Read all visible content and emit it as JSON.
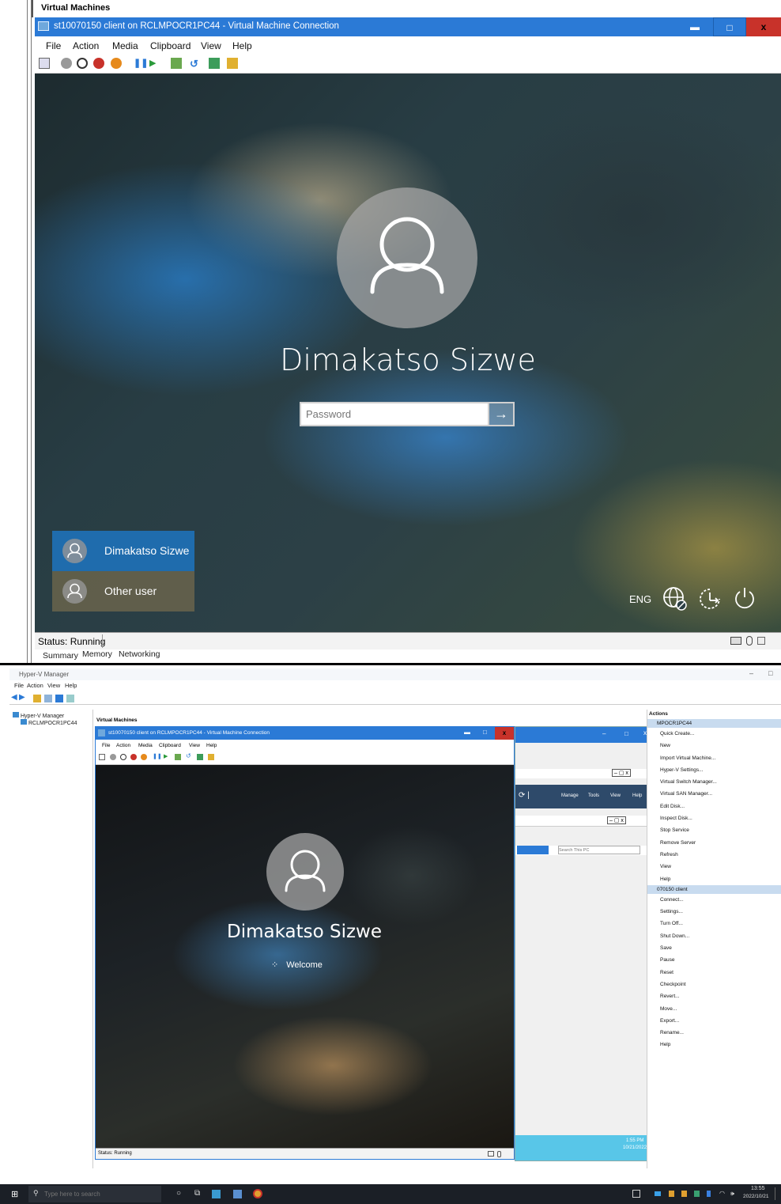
{
  "top": {
    "vm_section_header": "Virtual Machines",
    "window_title": "st10070150 client on RCLMPOCR1PC44 - Virtual Machine Connection",
    "menu": [
      "File",
      "Action",
      "Media",
      "Clipboard",
      "View",
      "Help"
    ],
    "lock": {
      "username": "Dimakatso Sizwe",
      "password_placeholder": "Password",
      "submit_arrow": "→",
      "users": [
        "Dimakatso Sizwe",
        "Other user"
      ],
      "language": "ENG"
    },
    "status": "Status: Running",
    "tabs": [
      "Summary",
      "Memory",
      "Networking"
    ]
  },
  "bottom": {
    "app_title": "Hyper-V Manager",
    "menu": [
      "File",
      "Action",
      "View",
      "Help"
    ],
    "tree": {
      "root": "Hyper-V Manager",
      "host": "RCLMPOCR1PC44"
    },
    "center_header": "Virtual Machines",
    "inner_window": {
      "title": "st10070150 client on RCLMPOCR1PC44 - Virtual Machine Connection",
      "menu": [
        "File",
        "Action",
        "Media",
        "Clipboard",
        "View",
        "Help"
      ],
      "username": "Dimakatso Sizwe",
      "welcome": "Welcome",
      "status": "Status: Running"
    },
    "server_manager": {
      "menu": [
        "Manage",
        "Tools",
        "View",
        "Help"
      ],
      "search_placeholder": "Search This PC",
      "time": "1:55 PM",
      "date": "10/21/2022"
    },
    "actions": {
      "header": "Actions",
      "host_group": "MPOCR1PC44",
      "host_items": [
        "Quick Create...",
        "New",
        "Import Virtual Machine...",
        "Hyper-V Settings...",
        "Virtual Switch Manager...",
        "Virtual SAN Manager...",
        "Edit Disk...",
        "Inspect Disk...",
        "Stop Service",
        "Remove Server",
        "Refresh",
        "View",
        "Help"
      ],
      "vm_group": "070150 client",
      "vm_items": [
        "Connect...",
        "Settings...",
        "Turn Off...",
        "Shut Down...",
        "Save",
        "Pause",
        "Reset",
        "Checkpoint",
        "Revert...",
        "Move...",
        "Export...",
        "Rename...",
        "Help"
      ]
    },
    "taskbar": {
      "search_placeholder": "Type here to search",
      "time": "13:55",
      "date": "2022/10/21"
    }
  },
  "colors": {
    "titlebar_blue": "#2b7ad6",
    "close_red": "#c8322a",
    "selected_tile": "#1f6cad"
  }
}
